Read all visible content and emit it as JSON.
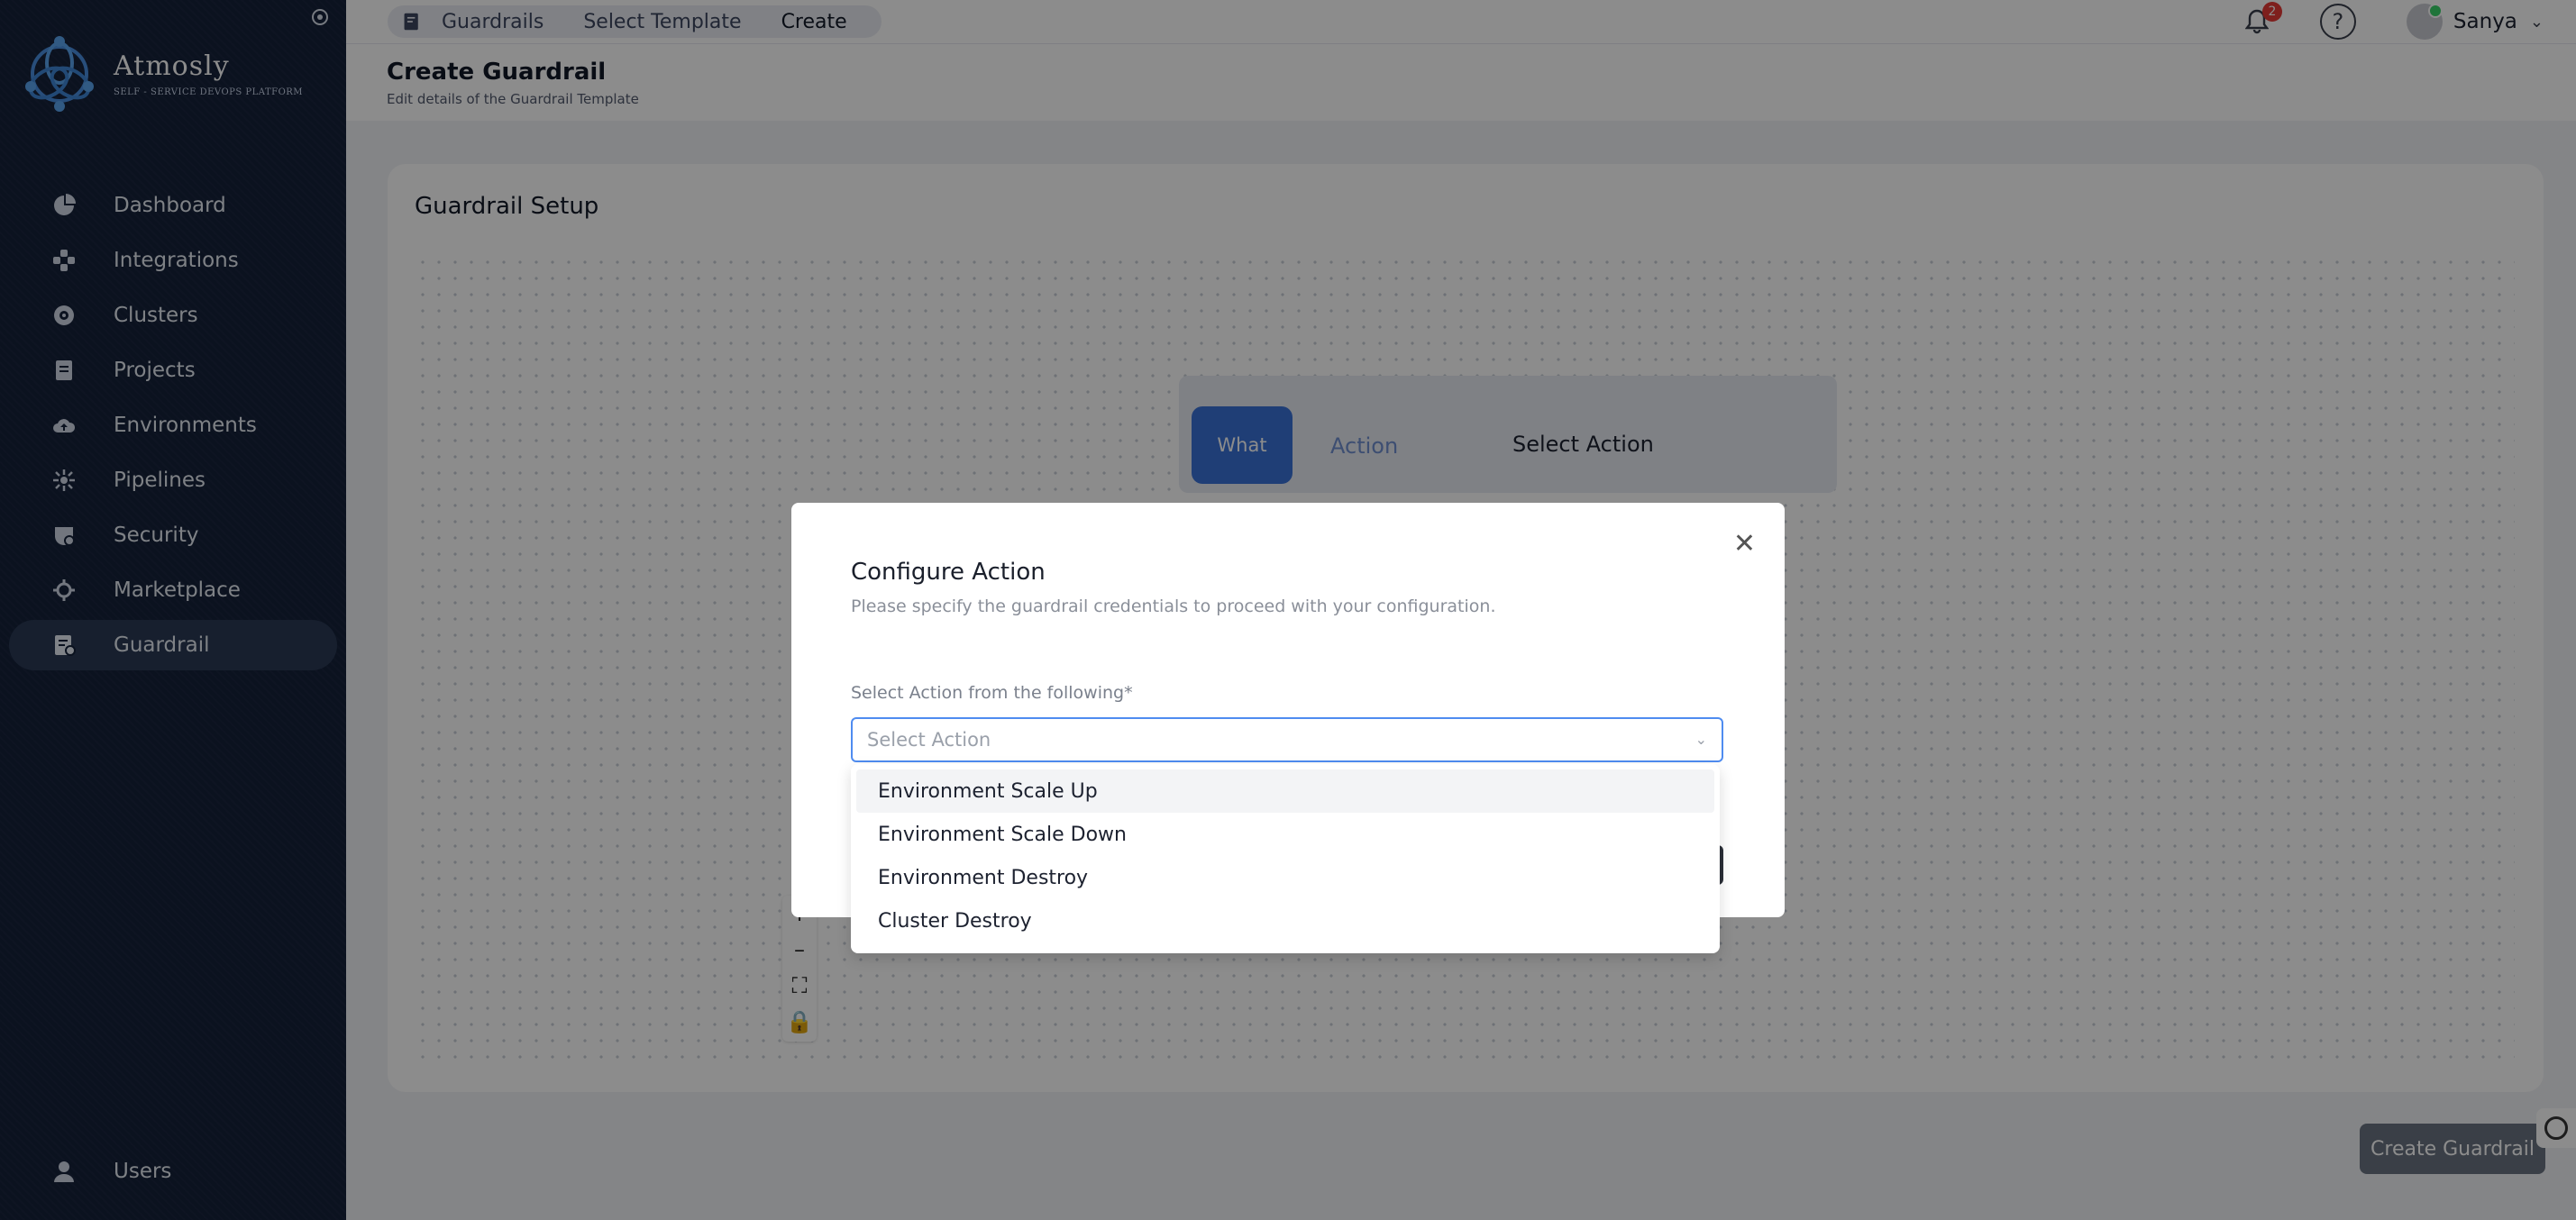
{
  "brand": {
    "name": "Atmosly",
    "tagline": "SELF - SERVICE DEVOPS PLATFORM"
  },
  "sidebar": {
    "items": [
      {
        "label": "Dashboard",
        "icon": "pie-chart-icon"
      },
      {
        "label": "Integrations",
        "icon": "puzzle-icon"
      },
      {
        "label": "Clusters",
        "icon": "cluster-icon"
      },
      {
        "label": "Projects",
        "icon": "folder-icon"
      },
      {
        "label": "Environments",
        "icon": "cloud-upload-icon"
      },
      {
        "label": "Pipelines",
        "icon": "pipeline-icon"
      },
      {
        "label": "Security",
        "icon": "shield-icon"
      },
      {
        "label": "Marketplace",
        "icon": "gear-icon"
      },
      {
        "label": "Guardrail",
        "icon": "guardrail-icon"
      }
    ],
    "active": "Guardrail",
    "bottom_items": [
      {
        "label": "Users",
        "icon": "user-icon"
      }
    ]
  },
  "topbar": {
    "breadcrumbs": [
      "Guardrails",
      "Select Template",
      "Create"
    ],
    "notifications_count": "2",
    "help_symbol": "?",
    "user_name": "Sanya"
  },
  "page": {
    "title": "Create Guardrail",
    "subtitle": "Edit details of the Guardrail Template"
  },
  "card": {
    "title": "Guardrail Setup",
    "node": {
      "what_label": "What",
      "action_label": "Action",
      "select_label": "Select Action"
    },
    "zoom_controls": [
      "+",
      "–",
      "⛶",
      "🔒"
    ]
  },
  "create_button": "Create Guardrail",
  "modal": {
    "title": "Configure Action",
    "subtitle": "Please specify the guardrail credentials to proceed with your configuration.",
    "field_label": "Select Action from the following*",
    "placeholder": "Select Action",
    "options": [
      "Environment Scale Up",
      "Environment Scale Down",
      "Environment Destroy",
      "Cluster Destroy"
    ],
    "hovered_option": "Environment Scale Up"
  },
  "colors": {
    "sidebar_bg": "#14213a",
    "accent_blue": "#3a72d8",
    "focus_border": "#4f8cf0",
    "badge_red": "#e53935"
  }
}
